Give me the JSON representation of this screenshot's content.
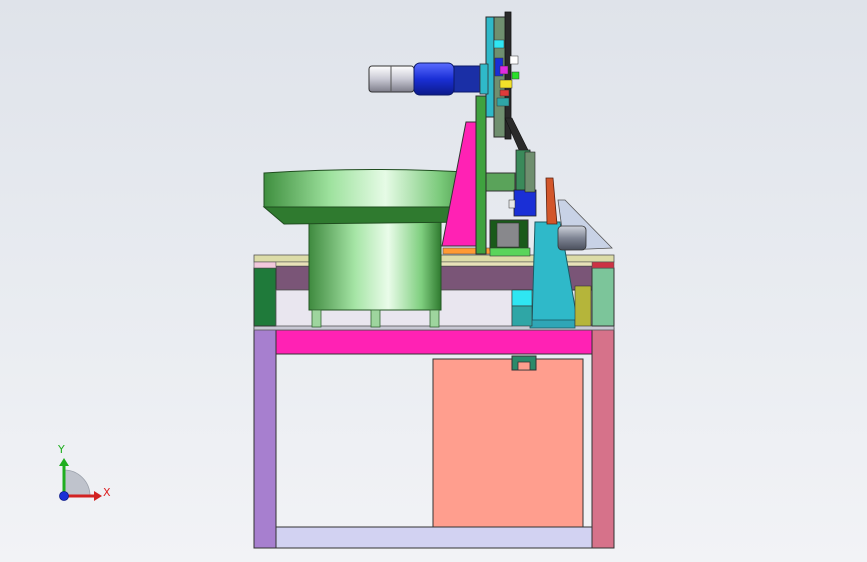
{
  "viewport": {
    "background_top": "#dfe3ea",
    "background_bottom": "#f2f3f6"
  },
  "triad": {
    "x_label": "X",
    "y_label": "Y",
    "x_color": "#d22222",
    "y_color": "#1fae1f",
    "z_color": "#1a2fd6"
  },
  "assembly": {
    "frame_colors": {
      "left_leg": "#a77fcf",
      "right_leg": "#d6728a",
      "top_beam": "#ff22b4",
      "bottom_beam": "#d2d2f2",
      "electrical_box": "#ff9e8e",
      "table_top": "#7a5577",
      "edge_strip": "#dcdca8"
    },
    "feeder_bowl_color": "#7fd77f",
    "motor_color": "#1a2fd6",
    "column_color": "#2fb9c9"
  }
}
